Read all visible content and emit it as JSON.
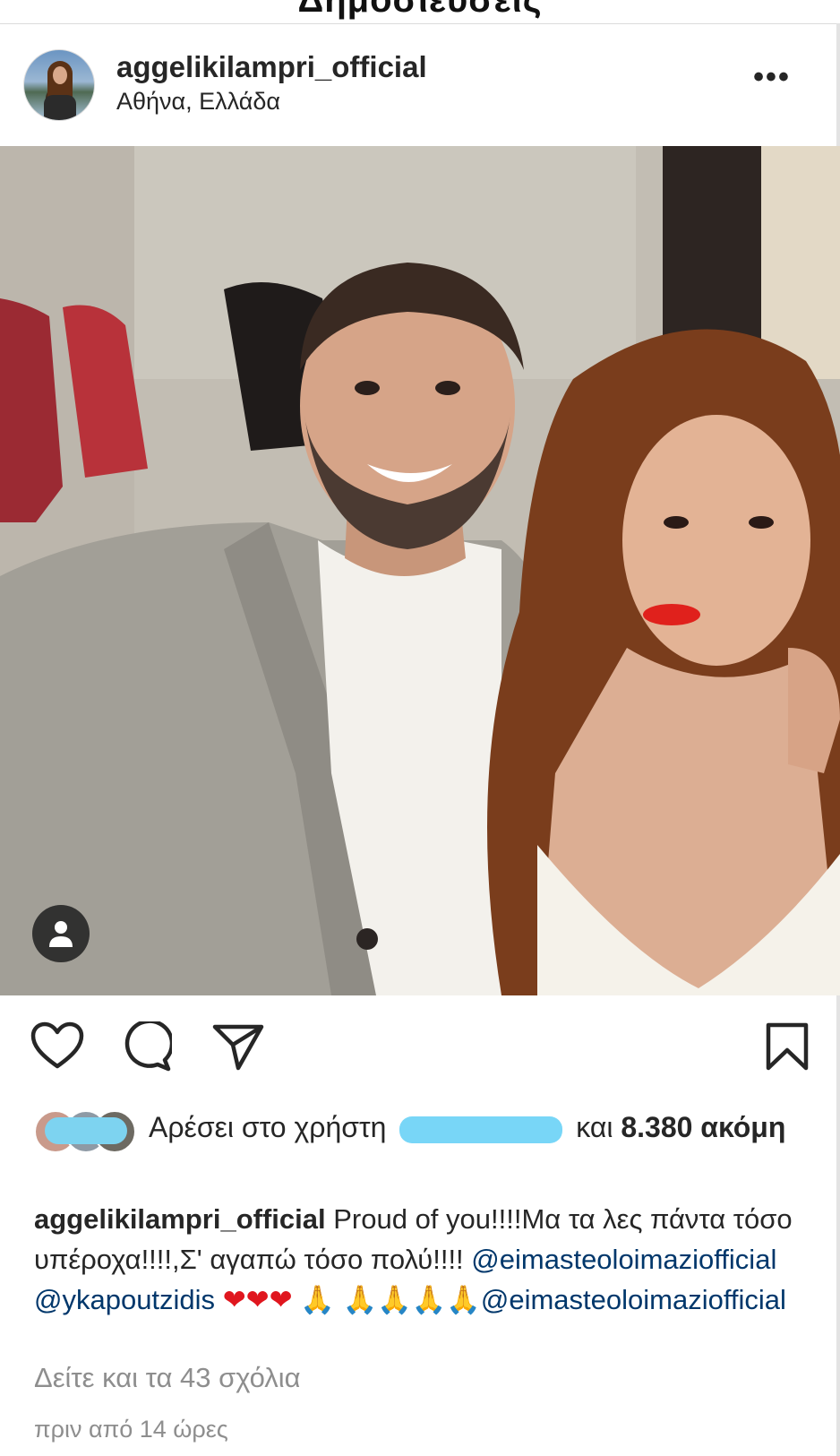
{
  "page": {
    "top_title": "Δημοσιεύσεις"
  },
  "post": {
    "username": "aggelikilampri_official",
    "location": "Αθήνα, Ελλάδα",
    "more_label": "•••",
    "photo_alt": "",
    "likes": {
      "prefix": "Αρέσει στο χρήστη",
      "and": "και",
      "count": "8.380",
      "suffix": "ακόμη"
    },
    "caption": {
      "username": "aggelikilampri_official",
      "text_1": "Proud of you!!!!Μα τα λες πάντα τόσο υπέροχα!!!!,Σ' αγαπώ τόσο πολύ!!!!",
      "mention_1": "@eimasteoloimaziofficial",
      "mention_2": "@ykapoutzidis",
      "hearts": "❤❤❤",
      "prays_1": "🙏",
      "prays_2": "🙏🙏🙏🙏",
      "mention_3": "@eimasteoloimaziofficial"
    },
    "view_comments": "Δείτε και τα 43 σχόλια",
    "timestamp": "πριν από 14 ώρες"
  },
  "icons": {
    "like": "heart-outline-icon",
    "comment": "comment-bubble-icon",
    "share": "paper-plane-icon",
    "save": "bookmark-icon",
    "people_tag": "person-icon"
  },
  "colors": {
    "text": "#262626",
    "secondary_text": "#8e8e8e",
    "mention": "#00376b",
    "blur_overlay": "#78d6f7"
  }
}
